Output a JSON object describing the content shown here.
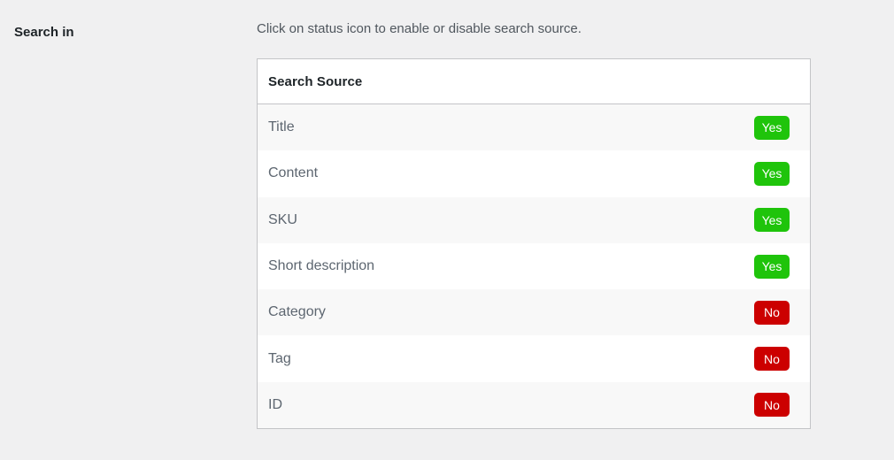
{
  "field": {
    "label": "Search in",
    "help_text": "Click on status icon to enable or disable search source."
  },
  "table": {
    "header": "Search Source",
    "rows": [
      {
        "name": "Title",
        "status": "Yes",
        "state": "yes"
      },
      {
        "name": "Content",
        "status": "Yes",
        "state": "yes"
      },
      {
        "name": "SKU",
        "status": "Yes",
        "state": "yes"
      },
      {
        "name": "Short description",
        "status": "Yes",
        "state": "yes"
      },
      {
        "name": "Category",
        "status": "No",
        "state": "no"
      },
      {
        "name": "Tag",
        "status": "No",
        "state": "no"
      },
      {
        "name": "ID",
        "status": "No",
        "state": "no"
      }
    ]
  },
  "colors": {
    "page_background": "#f0f0f1",
    "table_background": "#ffffff",
    "table_alt_row": "#f8f8f8",
    "table_border": "#c3c4c7",
    "badge_yes": "#1fc40b",
    "badge_no": "#cc0000",
    "heading_text": "#1d2327",
    "row_text": "#5d6670",
    "help_text": "#50575e"
  }
}
